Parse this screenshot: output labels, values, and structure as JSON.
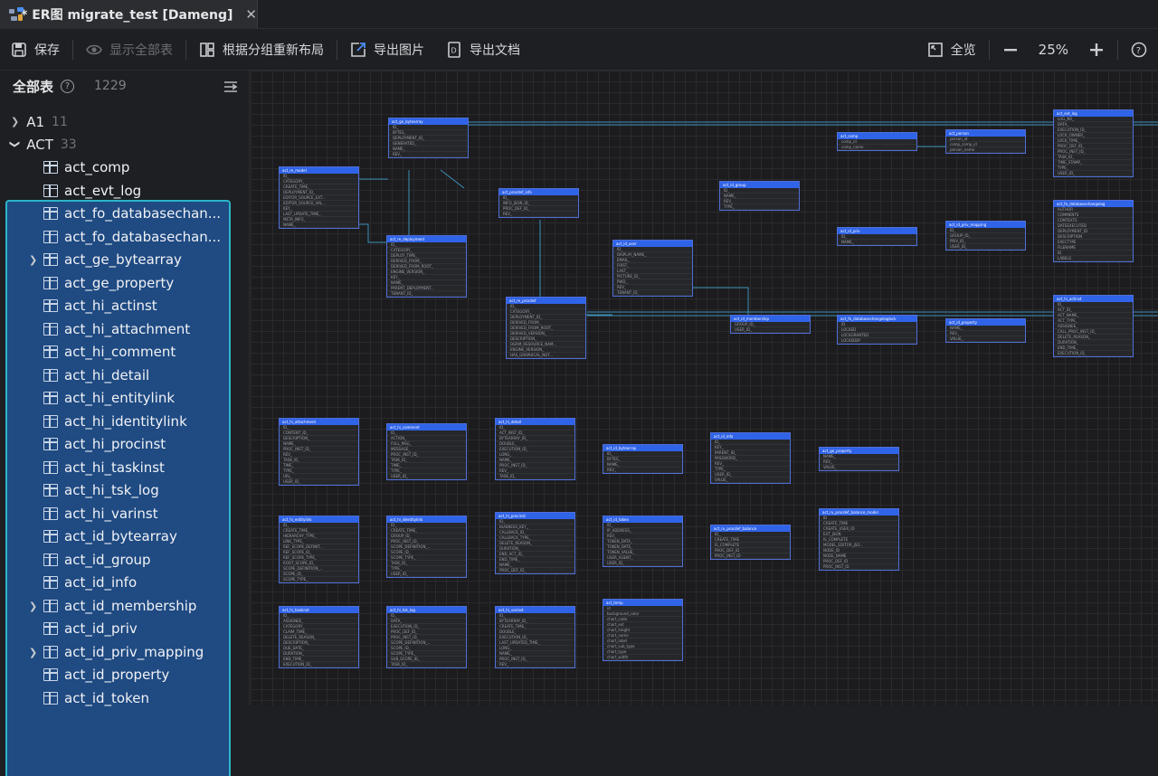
{
  "tab": {
    "title": "* ER图 migrate_test [Dameng]",
    "close": "✕"
  },
  "toolbar": {
    "save": "保存",
    "show_all": "显示全部表",
    "relayout": "根据分组重新布局",
    "export_image": "导出图片",
    "export_doc": "导出文档",
    "overview": "全览",
    "zoom": "25%"
  },
  "sidebar": {
    "title": "全部表",
    "count": "1229",
    "groups": [
      {
        "name": "A1",
        "count": "11"
      },
      {
        "name": "ACT",
        "count": "33"
      }
    ],
    "items": [
      {
        "label": "act_comp",
        "expand": false
      },
      {
        "label": "act_evt_log",
        "expand": false
      },
      {
        "label": "act_fo_databasechan...",
        "expand": false
      },
      {
        "label": "act_fo_databasechan...",
        "expand": false
      },
      {
        "label": "act_ge_bytearray",
        "expand": true
      },
      {
        "label": "act_ge_property",
        "expand": false
      },
      {
        "label": "act_hi_actinst",
        "expand": false
      },
      {
        "label": "act_hi_attachment",
        "expand": false
      },
      {
        "label": "act_hi_comment",
        "expand": false
      },
      {
        "label": "act_hi_detail",
        "expand": false
      },
      {
        "label": "act_hi_entitylink",
        "expand": false
      },
      {
        "label": "act_hi_identitylink",
        "expand": false
      },
      {
        "label": "act_hi_procinst",
        "expand": false
      },
      {
        "label": "act_hi_taskinst",
        "expand": false
      },
      {
        "label": "act_hi_tsk_log",
        "expand": false
      },
      {
        "label": "act_hi_varinst",
        "expand": false
      },
      {
        "label": "act_id_bytearray",
        "expand": false
      },
      {
        "label": "act_id_group",
        "expand": false
      },
      {
        "label": "act_id_info",
        "expand": false
      },
      {
        "label": "act_id_membership",
        "expand": true
      },
      {
        "label": "act_id_priv",
        "expand": false
      },
      {
        "label": "act_id_priv_mapping",
        "expand": true
      },
      {
        "label": "act_id_property",
        "expand": false
      },
      {
        "label": "act_id_token",
        "expand": false
      }
    ]
  },
  "colors": {
    "accent": "#2f63e8",
    "selection": "#1f4a82",
    "selection_border": "#2bb5c9"
  },
  "icons": {
    "save": "save-icon",
    "show_all": "eye-icon",
    "relayout": "layout-icon",
    "export_image": "export-image-icon",
    "export_doc": "document-icon",
    "overview": "overview-icon",
    "zoom_out": "minus-icon",
    "zoom_in": "plus-icon",
    "help": "help-icon"
  },
  "er": {
    "entities": [
      {
        "name": "act_ge_bytearray",
        "rows": [
          "ID_",
          "BYTES_",
          "DEPLOYMENT_ID_",
          "GENERATED_",
          "NAME_",
          "REV_"
        ]
      },
      {
        "name": "act_re_model",
        "rows": [
          "ID_",
          "CATEGORY_",
          "CREATE_TIME_",
          "DEPLOYMENT_ID_",
          "EDITOR_SOURCE_EXT...",
          "EDITOR_SOURCE_VAL...",
          "KEY_",
          "LAST_UPDATE_TIME_",
          "META_INFO_",
          "NAME_"
        ]
      },
      {
        "name": "act_procdef_info",
        "rows": [
          "ID_",
          "INFO_JSON_ID_",
          "PROC_DEF_ID_",
          "REV_"
        ]
      },
      {
        "name": "act_re_deployment",
        "rows": [
          "ID_",
          "CATEGORY_",
          "DEPLOY_TIME_",
          "DERIVED_FROM_",
          "DERIVED_FROM_ROOT_",
          "ENGINE_VERSION_",
          "KEY_",
          "NAME_",
          "PARENT_DEPLOYMENT...",
          "TENANT_ID_"
        ]
      },
      {
        "name": "act_id_user",
        "rows": [
          "ID_",
          "DISPLAY_NAME_",
          "EMAIL_",
          "FIRST_",
          "LAST_",
          "PICTURE_ID_",
          "PWD_",
          "REV_",
          "TENANT_ID_"
        ]
      },
      {
        "name": "act_re_procdef",
        "rows": [
          "ID_",
          "CATEGORY_",
          "DEPLOYMENT_ID_",
          "DERIVED_FROM_",
          "DERIVED_FROM_ROOT_",
          "DERIVED_VERSION_",
          "DESCRIPTION_",
          "DGRM_RESOURCE_NAM...",
          "ENGINE_VERSION_",
          "HAS_GRAPHICAL_NOT..."
        ]
      },
      {
        "name": "act_id_group",
        "rows": [
          "ID_",
          "NAME_",
          "REV_",
          "TYPE_"
        ]
      },
      {
        "name": "act_comp",
        "rows": [
          "comp_id",
          "comp_name"
        ]
      },
      {
        "name": "act_person",
        "rows": [
          "person_id",
          "comp_comp_id",
          "person_name"
        ]
      },
      {
        "name": "act_evt_log",
        "rows": [
          "LOG_NR_",
          "DATA_",
          "EXECUTION_ID_",
          "LOCK_OWNER_",
          "LOCK_TIME_",
          "PROC_DEF_ID_",
          "PROC_INST_ID_",
          "TASK_ID_",
          "TIME_STAMP_",
          "TYPE_",
          "USER_ID_"
        ]
      },
      {
        "name": "act_id_priv",
        "rows": [
          "ID_",
          "NAME_"
        ]
      },
      {
        "name": "act_id_priv_mapping",
        "rows": [
          "ID_",
          "GROUP_ID_",
          "PRIV_ID_",
          "USER_ID_"
        ]
      },
      {
        "name": "act_fo_databasechangelog",
        "rows": [
          "AUTHOR",
          "COMMENTS",
          "CONTEXTS",
          "DATEEXECUTED",
          "DEPLOYMENT_ID",
          "DESCRIPTION",
          "EXECTYPE",
          "FILENAME",
          "ID",
          "LABELS"
        ]
      },
      {
        "name": "act_id_membership",
        "rows": [
          "GROUP_ID_",
          "USER_ID_"
        ]
      },
      {
        "name": "act_fo_databasechangeloglock",
        "rows": [
          "ID",
          "LOCKED",
          "LOCKGRANTED",
          "LOCKEDBY"
        ]
      },
      {
        "name": "act_id_property",
        "rows": [
          "NAME_",
          "REV_",
          "VALUE_"
        ]
      },
      {
        "name": "act_hi_actinst",
        "rows": [
          "ID_",
          "ACT_ID_",
          "ACT_NAME_",
          "ACT_TYPE_",
          "ASSIGNEE_",
          "CALL_PROC_INST_ID_",
          "DELETE_REASON_",
          "DURATION_",
          "END_TIME_",
          "EXECUTION_ID_"
        ]
      },
      {
        "name": "act_hi_attachment",
        "rows": [
          "ID_",
          "CONTENT_ID_",
          "DESCRIPTION_",
          "NAME_",
          "PROC_INST_ID_",
          "REV_",
          "TASK_ID_",
          "TIME_",
          "TYPE_",
          "URL_",
          "USER_ID_"
        ]
      },
      {
        "name": "act_hi_comment",
        "rows": [
          "ID_",
          "ACTION_",
          "FULL_MSG_",
          "MESSAGE_",
          "PROC_INST_ID_",
          "TASK_ID_",
          "TIME_",
          "TYPE_",
          "USER_ID_"
        ]
      },
      {
        "name": "act_hi_detail",
        "rows": [
          "ID_",
          "ACT_INST_ID_",
          "BYTEARRAY_ID_",
          "DOUBLE_",
          "EXECUTION_ID_",
          "LONG_",
          "NAME_",
          "PROC_INST_ID_",
          "REV_",
          "TASK_ID_"
        ]
      },
      {
        "name": "act_id_bytearray",
        "rows": [
          "ID_",
          "BYTES_",
          "NAME_",
          "REV_"
        ]
      },
      {
        "name": "act_id_info",
        "rows": [
          "ID_",
          "KEY_",
          "PARENT_ID_",
          "PASSWORD_",
          "REV_",
          "TYPE_",
          "USER_ID_",
          "VALUE_"
        ]
      },
      {
        "name": "act_ge_property",
        "rows": [
          "NAME_",
          "REV_",
          "VALUE_"
        ]
      },
      {
        "name": "act_hi_entitylink",
        "rows": [
          "ID_",
          "CREATE_TIME_",
          "HIERARCHY_TYPE_",
          "LINK_TYPE_",
          "REF_SCOPE_DEFINIT...",
          "REF_SCOPE_ID_",
          "REF_SCOPE_TYPE_",
          "ROOT_SCOPE_ID_",
          "SCOPE_DEFINITION_...",
          "SCOPE_ID_",
          "SCOPE_TYPE_"
        ]
      },
      {
        "name": "act_hi_identitylink",
        "rows": [
          "ID_",
          "CREATE_TIME_",
          "GROUP_ID_",
          "PROC_INST_ID_",
          "SCOPE_DEFINITION_...",
          "SCOPE_ID_",
          "SCOPE_TYPE_",
          "TASK_ID_",
          "TYPE_",
          "USER_ID_"
        ]
      },
      {
        "name": "act_hi_procinst",
        "rows": [
          "ID_",
          "BUSINESS_KEY_",
          "CALLBACK_ID_",
          "CALLBACK_TYPE_",
          "DELETE_REASON_",
          "DURATION_",
          "END_ACT_ID_",
          "END_TIME_",
          "NAME_",
          "PROC_DEF_ID_"
        ]
      },
      {
        "name": "act_id_token",
        "rows": [
          "ID_",
          "IP_ADDRESS_",
          "REV_",
          "TOKEN_DATA_",
          "TOKEN_DATE_",
          "TOKEN_VALUE_",
          "USER_AGENT_",
          "USER_ID_"
        ]
      },
      {
        "name": "act_ru_procdef_balance",
        "rows": [
          "ID_",
          "CREATE_TIME",
          "IS_COMPLETE",
          "PROC_DEF_ID",
          "PROC_INST_ID"
        ]
      },
      {
        "name": "act_ru_procdef_balance_model",
        "rows": [
          "ID",
          "CREATE_TIME",
          "CREATE_USER_ID",
          "EXT_JSON",
          "IS_COMPLETE",
          "MODEL_EDITOR_JSO...",
          "NODE_ID",
          "NODE_NAME",
          "PROC_DEF_ID",
          "PROC_INST_ID"
        ]
      },
      {
        "name": "act_hi_taskinst",
        "rows": [
          "ID_",
          "ASSIGNEE_",
          "CATEGORY_",
          "CLAIM_TIME_",
          "DELETE_REASON_",
          "DESCRIPTION_",
          "DUE_DATE_",
          "DURATION_",
          "END_TIME_",
          "EXECUTION_ID_"
        ]
      },
      {
        "name": "act_hi_tsk_log",
        "rows": [
          "ID_",
          "DATA_",
          "EXECUTION_ID_",
          "PROC_DEF_ID_",
          "PROC_INST_ID_",
          "SCOPE_DEFINITION_...",
          "SCOPE_ID_",
          "SCOPE_TYPE_",
          "SUB_SCOPE_ID_",
          "TASK_ID_"
        ]
      },
      {
        "name": "act_hi_varinst",
        "rows": [
          "ID_",
          "BYTEARRAY_ID_",
          "CREATE_TIME_",
          "DOUBLE_",
          "EXECUTION_ID_",
          "LAST_UPDATED_TIME_",
          "LONG_",
          "NAME_",
          "PROC_INST_ID_",
          "REV_"
        ]
      },
      {
        "name": "act_temp",
        "rows": [
          "id",
          "background_color",
          "chart_code",
          "chart_ext",
          "chart_height",
          "chart_name",
          "chart_label",
          "chart_sub_type",
          "chart_type",
          "chart_width"
        ]
      }
    ]
  }
}
